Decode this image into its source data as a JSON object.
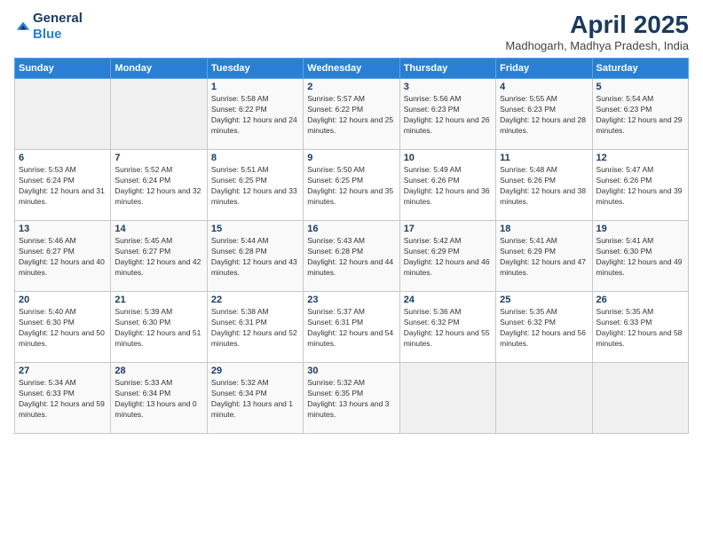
{
  "header": {
    "logo_general": "General",
    "logo_blue": "Blue",
    "title": "April 2025",
    "subtitle": "Madhogarh, Madhya Pradesh, India"
  },
  "days_of_week": [
    "Sunday",
    "Monday",
    "Tuesday",
    "Wednesday",
    "Thursday",
    "Friday",
    "Saturday"
  ],
  "weeks": [
    [
      {
        "day": "",
        "info": ""
      },
      {
        "day": "",
        "info": ""
      },
      {
        "day": "1",
        "info": "Sunrise: 5:58 AM\nSunset: 6:22 PM\nDaylight: 12 hours and 24 minutes."
      },
      {
        "day": "2",
        "info": "Sunrise: 5:57 AM\nSunset: 6:22 PM\nDaylight: 12 hours and 25 minutes."
      },
      {
        "day": "3",
        "info": "Sunrise: 5:56 AM\nSunset: 6:23 PM\nDaylight: 12 hours and 26 minutes."
      },
      {
        "day": "4",
        "info": "Sunrise: 5:55 AM\nSunset: 6:23 PM\nDaylight: 12 hours and 28 minutes."
      },
      {
        "day": "5",
        "info": "Sunrise: 5:54 AM\nSunset: 6:23 PM\nDaylight: 12 hours and 29 minutes."
      }
    ],
    [
      {
        "day": "6",
        "info": "Sunrise: 5:53 AM\nSunset: 6:24 PM\nDaylight: 12 hours and 31 minutes."
      },
      {
        "day": "7",
        "info": "Sunrise: 5:52 AM\nSunset: 6:24 PM\nDaylight: 12 hours and 32 minutes."
      },
      {
        "day": "8",
        "info": "Sunrise: 5:51 AM\nSunset: 6:25 PM\nDaylight: 12 hours and 33 minutes."
      },
      {
        "day": "9",
        "info": "Sunrise: 5:50 AM\nSunset: 6:25 PM\nDaylight: 12 hours and 35 minutes."
      },
      {
        "day": "10",
        "info": "Sunrise: 5:49 AM\nSunset: 6:26 PM\nDaylight: 12 hours and 36 minutes."
      },
      {
        "day": "11",
        "info": "Sunrise: 5:48 AM\nSunset: 6:26 PM\nDaylight: 12 hours and 38 minutes."
      },
      {
        "day": "12",
        "info": "Sunrise: 5:47 AM\nSunset: 6:26 PM\nDaylight: 12 hours and 39 minutes."
      }
    ],
    [
      {
        "day": "13",
        "info": "Sunrise: 5:46 AM\nSunset: 6:27 PM\nDaylight: 12 hours and 40 minutes."
      },
      {
        "day": "14",
        "info": "Sunrise: 5:45 AM\nSunset: 6:27 PM\nDaylight: 12 hours and 42 minutes."
      },
      {
        "day": "15",
        "info": "Sunrise: 5:44 AM\nSunset: 6:28 PM\nDaylight: 12 hours and 43 minutes."
      },
      {
        "day": "16",
        "info": "Sunrise: 5:43 AM\nSunset: 6:28 PM\nDaylight: 12 hours and 44 minutes."
      },
      {
        "day": "17",
        "info": "Sunrise: 5:42 AM\nSunset: 6:29 PM\nDaylight: 12 hours and 46 minutes."
      },
      {
        "day": "18",
        "info": "Sunrise: 5:41 AM\nSunset: 6:29 PM\nDaylight: 12 hours and 47 minutes."
      },
      {
        "day": "19",
        "info": "Sunrise: 5:41 AM\nSunset: 6:30 PM\nDaylight: 12 hours and 49 minutes."
      }
    ],
    [
      {
        "day": "20",
        "info": "Sunrise: 5:40 AM\nSunset: 6:30 PM\nDaylight: 12 hours and 50 minutes."
      },
      {
        "day": "21",
        "info": "Sunrise: 5:39 AM\nSunset: 6:30 PM\nDaylight: 12 hours and 51 minutes."
      },
      {
        "day": "22",
        "info": "Sunrise: 5:38 AM\nSunset: 6:31 PM\nDaylight: 12 hours and 52 minutes."
      },
      {
        "day": "23",
        "info": "Sunrise: 5:37 AM\nSunset: 6:31 PM\nDaylight: 12 hours and 54 minutes."
      },
      {
        "day": "24",
        "info": "Sunrise: 5:36 AM\nSunset: 6:32 PM\nDaylight: 12 hours and 55 minutes."
      },
      {
        "day": "25",
        "info": "Sunrise: 5:35 AM\nSunset: 6:32 PM\nDaylight: 12 hours and 56 minutes."
      },
      {
        "day": "26",
        "info": "Sunrise: 5:35 AM\nSunset: 6:33 PM\nDaylight: 12 hours and 58 minutes."
      }
    ],
    [
      {
        "day": "27",
        "info": "Sunrise: 5:34 AM\nSunset: 6:33 PM\nDaylight: 12 hours and 59 minutes."
      },
      {
        "day": "28",
        "info": "Sunrise: 5:33 AM\nSunset: 6:34 PM\nDaylight: 13 hours and 0 minutes."
      },
      {
        "day": "29",
        "info": "Sunrise: 5:32 AM\nSunset: 6:34 PM\nDaylight: 13 hours and 1 minute."
      },
      {
        "day": "30",
        "info": "Sunrise: 5:32 AM\nSunset: 6:35 PM\nDaylight: 13 hours and 3 minutes."
      },
      {
        "day": "",
        "info": ""
      },
      {
        "day": "",
        "info": ""
      },
      {
        "day": "",
        "info": ""
      }
    ]
  ]
}
